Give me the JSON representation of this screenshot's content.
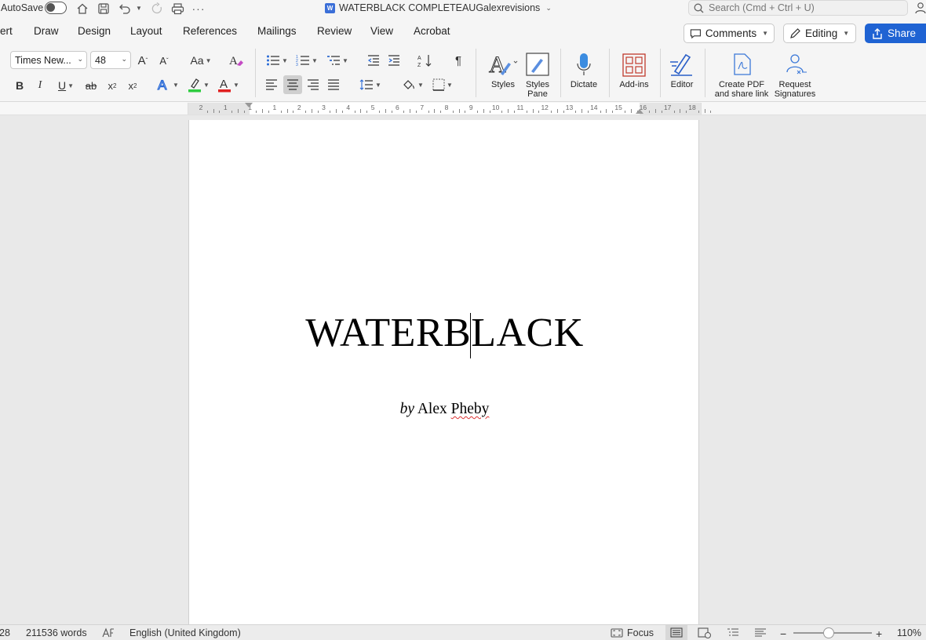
{
  "titlebar": {
    "autosave_label": "AutoSave",
    "document_title": "WATERBLACK COMPLETEAUGalexrevisions",
    "search_placeholder": "Search (Cmd + Ctrl + U)"
  },
  "tabs": {
    "items": [
      "ert",
      "Draw",
      "Design",
      "Layout",
      "References",
      "Mailings",
      "Review",
      "View",
      "Acrobat"
    ],
    "comments_label": "Comments",
    "editing_label": "Editing",
    "share_label": "Share"
  },
  "ribbon": {
    "font_name": "Times New...",
    "font_size": "48",
    "change_case_label": "Aa",
    "bold_label": "B",
    "italic_label": "I",
    "underline_label": "U",
    "strikethrough_label": "ab",
    "subscript_label": "x",
    "subscript_mark": "2",
    "superscript_label": "x",
    "superscript_mark": "2",
    "styles_label": "Styles",
    "styles_pane_label": "Styles Pane",
    "dictate_label": "Dictate",
    "addins_label": "Add-ins",
    "editor_label": "Editor",
    "create_pdf_label": "Create PDF and share link",
    "request_signatures_label": "Request Signatures",
    "highlight_color": "#2ecc40",
    "font_color": "#e02020"
  },
  "ruler": {
    "numbers": [
      "2",
      "1",
      "1",
      "1",
      "2",
      "3",
      "4",
      "5",
      "6",
      "7",
      "8",
      "9",
      "10",
      "11",
      "12",
      "13",
      "14",
      "15",
      "16",
      "17",
      "18"
    ]
  },
  "document": {
    "title": "WATERBLACK",
    "byline_prefix": "by",
    "byline_name": "Alex",
    "byline_surname": "Pheby"
  },
  "statusbar": {
    "page_fragment": "28",
    "word_count": "211536 words",
    "language": "English (United Kingdom)",
    "focus_label": "Focus",
    "zoom_level": "110%",
    "zoom_fraction": 0.45
  }
}
